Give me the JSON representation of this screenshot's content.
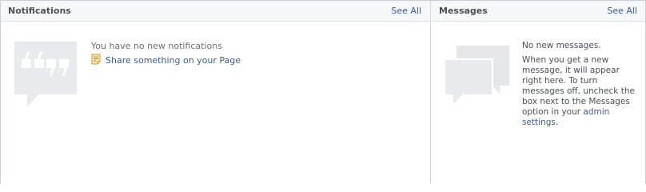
{
  "notifications": {
    "title": "Notifications",
    "see_all": "See All",
    "empty_text": "You have no new notifications",
    "share_link": "Share something on your Page",
    "icon_color": "#e9eaed"
  },
  "messages": {
    "title": "Messages",
    "see_all": "See All",
    "empty_title": "No new messages.",
    "empty_desc": "When you get a new message, it will appear right here. To turn messages off, uncheck the box next to the Messages option in your",
    "settings_link": "admin settings",
    "settings_suffix": "."
  },
  "colors": {
    "link": "#3b5998",
    "header_bg": "#f6f7f9",
    "placeholder_icon": "#e9eaed"
  }
}
